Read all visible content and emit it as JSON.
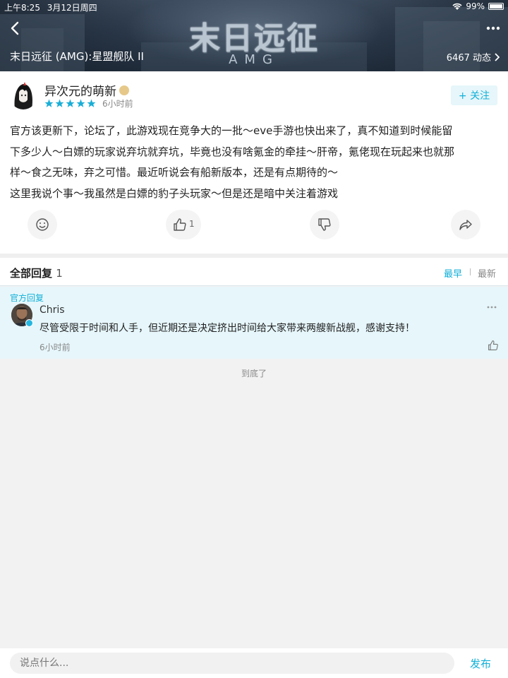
{
  "status_bar": {
    "time": "上午8:25",
    "date": "3月12日周四",
    "battery": "99%"
  },
  "banner": {
    "logo_cn": "末日远征",
    "logo_en": "AMG",
    "game_name": "末日远征 (AMG):星盟舰队 II",
    "dynamics": "6467 动态"
  },
  "post": {
    "username": "异次元的萌新",
    "rating": 5,
    "time": "6小时前",
    "follow_label": "+ 关注",
    "body_lines": [
      "官方该更新下，论坛了，此游戏现在竞争大的一批～eve手游也快出来了，真不知道到时候能留",
      "下多少人～白嫖的玩家说弃坑就弃坑，毕竟也没有啥氪金的牵挂～肝帝，氪佬现在玩起来也就那",
      "样～食之无味，弃之可惜。最近听说会有船新版本，还是有点期待的～",
      "这里我说个事～我虽然是白嫖的豹子头玩家～但是还是暗中关注着游戏"
    ],
    "like_count": "1"
  },
  "replies": {
    "title": "全部回复",
    "count": "1",
    "sort_early": "最早",
    "sort_latest": "最新",
    "items": [
      {
        "tag": "官方回复",
        "name": "Chris",
        "text": "尽管受限于时间和人手，但近期还是决定挤出时间给大家带来两艘新战舰，感谢支持！",
        "time": "6小时前"
      }
    ],
    "end_label": "到底了"
  },
  "input_bar": {
    "placeholder": "说点什么...",
    "publish_label": "发布"
  },
  "colors": {
    "accent": "#12b0d8",
    "reply_bg": "#e6f6fb",
    "star": "#1aaed6"
  }
}
